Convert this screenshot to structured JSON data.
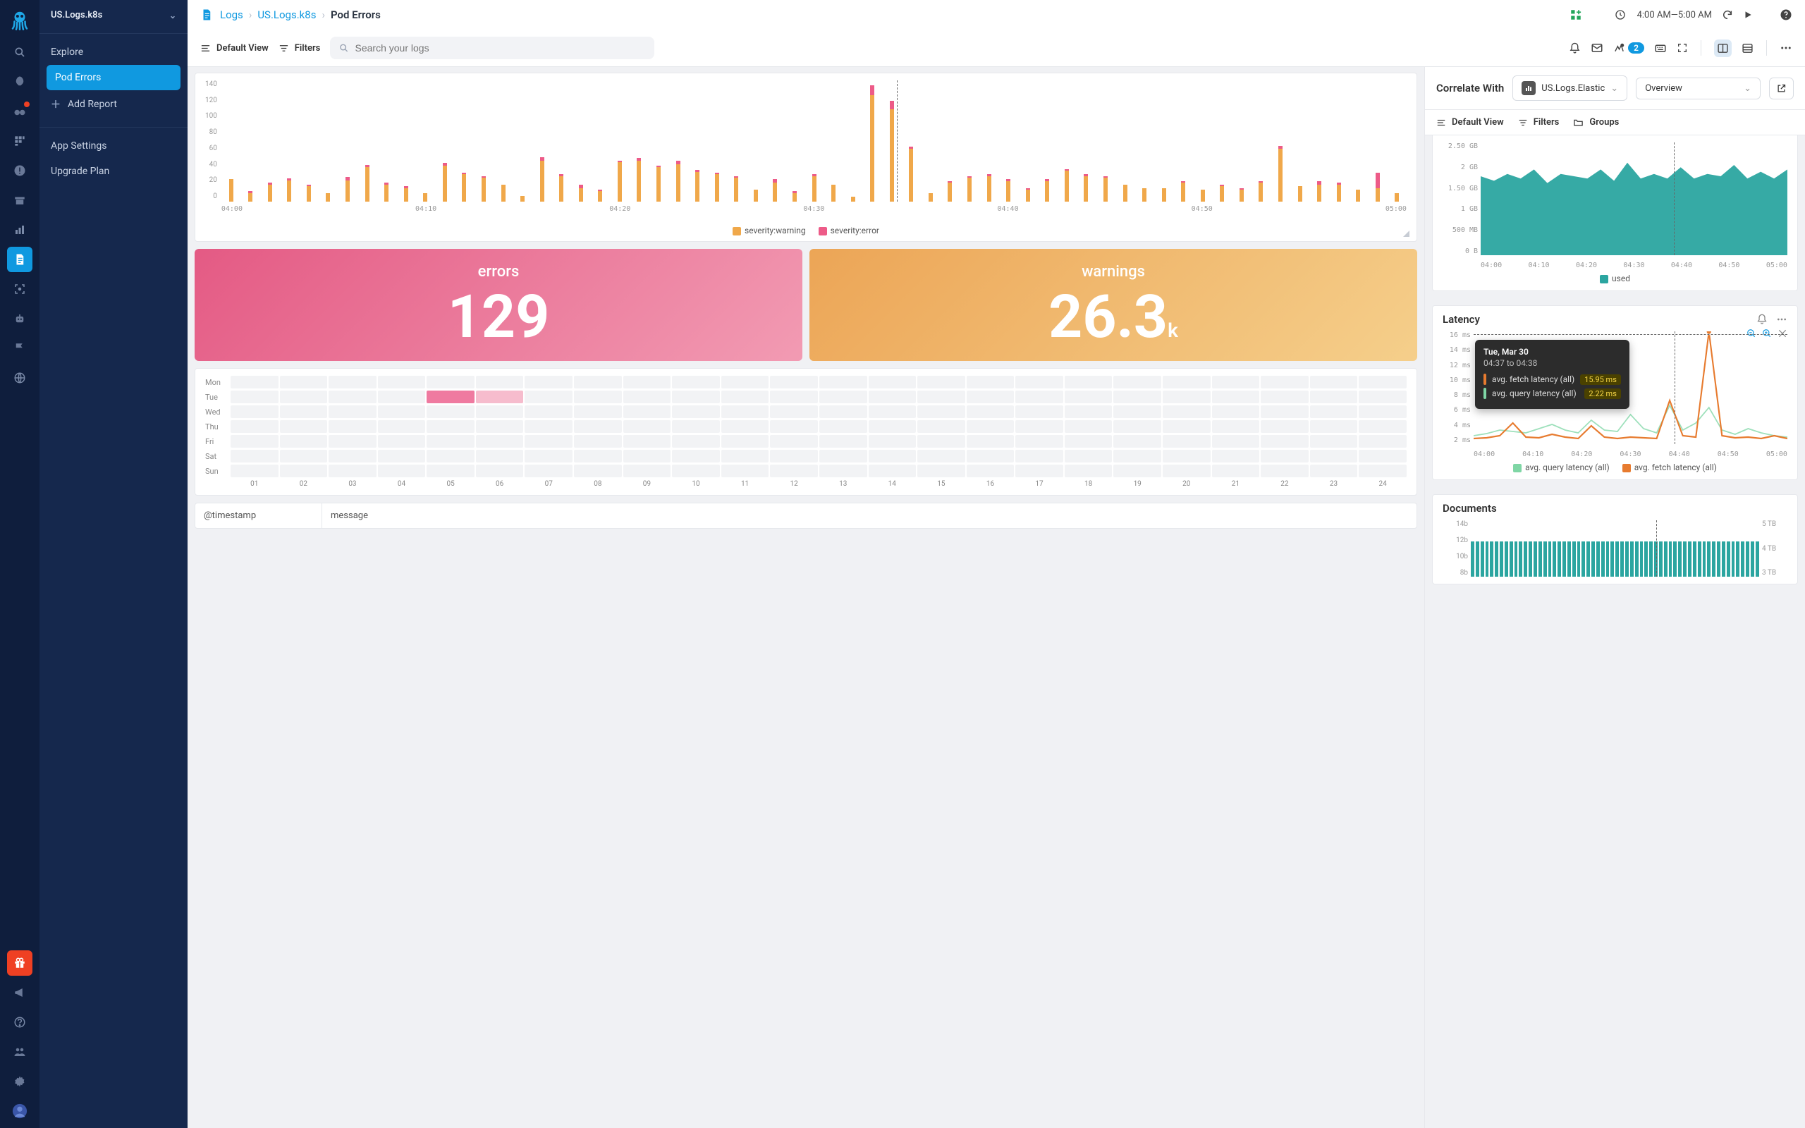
{
  "sidebar": {
    "title": "US.Logs.k8s",
    "items": [
      "Explore",
      "Pod Errors"
    ],
    "selected": 1,
    "add_report": "Add Report",
    "app_settings": "App Settings",
    "upgrade_plan": "Upgrade Plan"
  },
  "breadcrumb": {
    "root": "Logs",
    "mid": "US.Logs.k8s",
    "current": "Pod Errors"
  },
  "topbar": {
    "time_range": "4:00 AM—5:00 AM"
  },
  "toolbar": {
    "default_view": "Default View",
    "filters": "Filters",
    "search_placeholder": "Search your logs",
    "badge_count": "2"
  },
  "tiles": {
    "errors_label": "errors",
    "errors_value": "129",
    "warnings_label": "warnings",
    "warnings_value": "26.3",
    "warnings_unit": "k"
  },
  "heatmap": {
    "rows": [
      "Mon",
      "Tue",
      "Wed",
      "Thu",
      "Fri",
      "Sat",
      "Sun"
    ],
    "hours": [
      "01",
      "02",
      "03",
      "04",
      "05",
      "06",
      "07",
      "08",
      "09",
      "10",
      "11",
      "12",
      "13",
      "14",
      "15",
      "16",
      "17",
      "18",
      "19",
      "20",
      "21",
      "22",
      "23",
      "24"
    ],
    "highlights": [
      {
        "row": 1,
        "col": 4,
        "c": "#ef7aa0"
      },
      {
        "row": 1,
        "col": 5,
        "c": "#f6bccd"
      }
    ]
  },
  "table": {
    "col1": "@timestamp",
    "col2": "message"
  },
  "correlate": {
    "label": "Correlate With",
    "source": "US.Logs.Elastic",
    "view": "Overview",
    "default_view": "Default View",
    "filters": "Filters",
    "groups": "Groups"
  },
  "memory_chart": {
    "legend": "used",
    "yticks": [
      "2.50 GB",
      "2 GB",
      "1.50 GB",
      "1 GB",
      "500 MB",
      "0 B"
    ],
    "xticks": [
      "04:00",
      "04:10",
      "04:20",
      "04:30",
      "04:40",
      "04:50",
      "05:00"
    ]
  },
  "latency": {
    "title": "Latency",
    "yticks": [
      "16 ms",
      "14 ms",
      "12 ms",
      "10 ms",
      "8 ms",
      "6 ms",
      "4 ms",
      "2 ms"
    ],
    "xticks": [
      "04:00",
      "04:10",
      "04:20",
      "04:30",
      "04:40",
      "04:50",
      "05:00"
    ],
    "legend1": "avg. query latency (all)",
    "legend2": "avg. fetch latency (all)",
    "tooltip": {
      "date": "Tue, Mar 30",
      "range": "04:37 to 04:38",
      "r1_label": "avg. fetch latency (all)",
      "r1_val": "15.95 ms",
      "r2_label": "avg. query latency (all)",
      "r2_val": "2.22 ms"
    }
  },
  "documents": {
    "title": "Documents",
    "yleft": [
      "14b",
      "12b",
      "10b",
      "8b"
    ],
    "yright": [
      "5 TB",
      "4 TB",
      "3 TB"
    ]
  },
  "chart_data": {
    "severity_bars": {
      "type": "bar",
      "title": "",
      "xlabel": "",
      "ylabel": "",
      "ylim": [
        0,
        140
      ],
      "xticks": [
        "04:00",
        "04:10",
        "04:20",
        "04:30",
        "04:40",
        "04:50",
        "05:00"
      ],
      "series": [
        {
          "name": "severity:warning",
          "color": "#f0a84a",
          "values": [
            26,
            10,
            20,
            25,
            18,
            10,
            25,
            40,
            20,
            16,
            10,
            42,
            32,
            28,
            20,
            7,
            48,
            30,
            16,
            12,
            46,
            48,
            40,
            44,
            35,
            32,
            28,
            14,
            22,
            10,
            30,
            20,
            6,
            124,
            108,
            62,
            10,
            22,
            28,
            30,
            24,
            14,
            24,
            36,
            30,
            28,
            20,
            16,
            16,
            22,
            14,
            18,
            14,
            22,
            62,
            18,
            20,
            20,
            14,
            16,
            10
          ]
        },
        {
          "name": "severity:error",
          "color": "#ed5b88",
          "values": [
            0,
            2,
            2,
            2,
            2,
            0,
            4,
            3,
            2,
            2,
            0,
            3,
            2,
            2,
            0,
            0,
            4,
            2,
            4,
            2,
            2,
            3,
            2,
            4,
            2,
            2,
            2,
            0,
            4,
            2,
            2,
            0,
            0,
            12,
            10,
            2,
            0,
            2,
            2,
            2,
            2,
            2,
            2,
            2,
            2,
            2,
            0,
            0,
            0,
            2,
            0,
            2,
            2,
            2,
            3,
            0,
            4,
            2,
            0,
            18,
            0
          ]
        }
      ]
    },
    "memory_area": {
      "type": "area",
      "ylim": [
        0,
        2.5
      ],
      "yunit": "GB",
      "x": [
        "04:00",
        "04:10",
        "04:20",
        "04:30",
        "04:40",
        "04:50",
        "05:00"
      ],
      "series": [
        {
          "name": "used",
          "color": "#2ba5a0",
          "sample_values_gb": [
            1.75,
            1.65,
            1.8,
            1.7,
            1.9,
            1.6,
            1.8,
            1.75,
            1.7,
            1.9,
            1.65,
            2.05,
            1.7,
            1.8,
            1.7,
            1.95,
            1.7,
            1.8,
            1.75,
            2.0,
            1.7,
            1.85,
            1.7,
            1.9
          ]
        }
      ]
    },
    "latency_lines": {
      "type": "line",
      "ylim": [
        0,
        16
      ],
      "yunit": "ms",
      "x": [
        "04:00",
        "04:10",
        "04:20",
        "04:30",
        "04:40",
        "04:50",
        "05:00"
      ],
      "cursor_x": "04:37",
      "series": [
        {
          "name": "avg. query latency (all)",
          "color": "#7fd6a5",
          "sample_values": [
            1.2,
            1.5,
            2.0,
            1.8,
            1.6,
            2.2,
            2.8,
            2.0,
            1.6,
            3.4,
            2.0,
            1.8,
            4.2,
            2.2,
            1.6,
            5.5,
            2.0,
            3.0,
            5.2,
            2.0,
            1.4,
            2.2,
            1.6,
            1.2,
            1.0
          ]
        },
        {
          "name": "avg. fetch latency (all)",
          "color": "#e77b2f",
          "sample_values": [
            0.8,
            0.9,
            1.2,
            3.0,
            1.0,
            0.9,
            1.4,
            1.0,
            0.8,
            2.6,
            1.0,
            0.8,
            1.0,
            0.9,
            0.8,
            6.2,
            1.2,
            1.0,
            15.95,
            1.2,
            0.9,
            1.0,
            0.8,
            1.2,
            0.8
          ]
        }
      ]
    },
    "documents_bars": {
      "type": "bar",
      "yleft_lim": [
        8,
        14
      ],
      "yleft_unit": "b",
      "yright_lim": [
        3,
        5
      ],
      "yright_unit": "TB",
      "bar_value_approx": 12.2,
      "bar_count": 60
    }
  }
}
